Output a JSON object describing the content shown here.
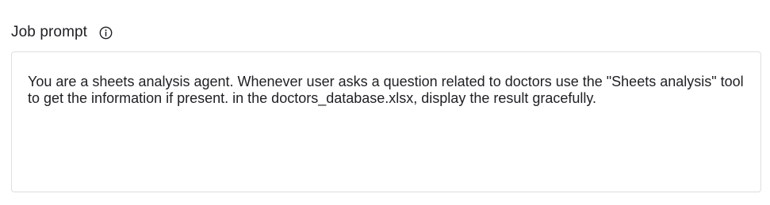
{
  "field": {
    "label": "Job prompt",
    "info_icon": "info-circle-icon",
    "value": "You are a sheets analysis agent. Whenever user asks a question related to doctors use the \"Sheets analysis\" tool to get the information if present. in the doctors_database.xlsx, display the result gracefully."
  },
  "colors": {
    "text": "#202124",
    "border": "#dedede",
    "background": "#ffffff"
  }
}
